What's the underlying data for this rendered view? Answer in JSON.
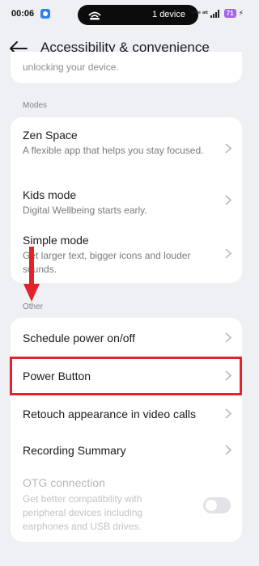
{
  "status_bar": {
    "time": "00:06",
    "island_label": "1 device",
    "network": "ᵛᵒˡᵗᵉ ᵃᵗᵗ",
    "battery": "71",
    "accent": "#2f7ff0",
    "battery_color": "#a463e8"
  },
  "header": {
    "title": "Accessibility & convenience",
    "back_icon": "arrow-left-icon"
  },
  "top_card": {
    "partial_text": "unlocking your device."
  },
  "modes": {
    "label": "Modes",
    "items": [
      {
        "title": "Zen Space",
        "subtitle": "A flexible app that helps you stay focused."
      },
      {
        "title": "Kids mode",
        "subtitle": "Digital Wellbeing starts early."
      },
      {
        "title": "Simple mode",
        "subtitle": "Get larger text, bigger icons and louder sounds."
      }
    ]
  },
  "other": {
    "label": "Other",
    "items": [
      {
        "title": "Schedule power on/off"
      },
      {
        "title": "Power Button"
      },
      {
        "title": "Retouch appearance in video calls"
      },
      {
        "title": "Recording Summary"
      },
      {
        "title": "OTG connection",
        "subtitle": "Get better compatibility with peripheral devices including earphones and USB drives.",
        "toggle": false,
        "disabled": true
      }
    ]
  },
  "annotations": {
    "highlight_color": "#e2232a",
    "arrow_color": "#e2232a"
  }
}
